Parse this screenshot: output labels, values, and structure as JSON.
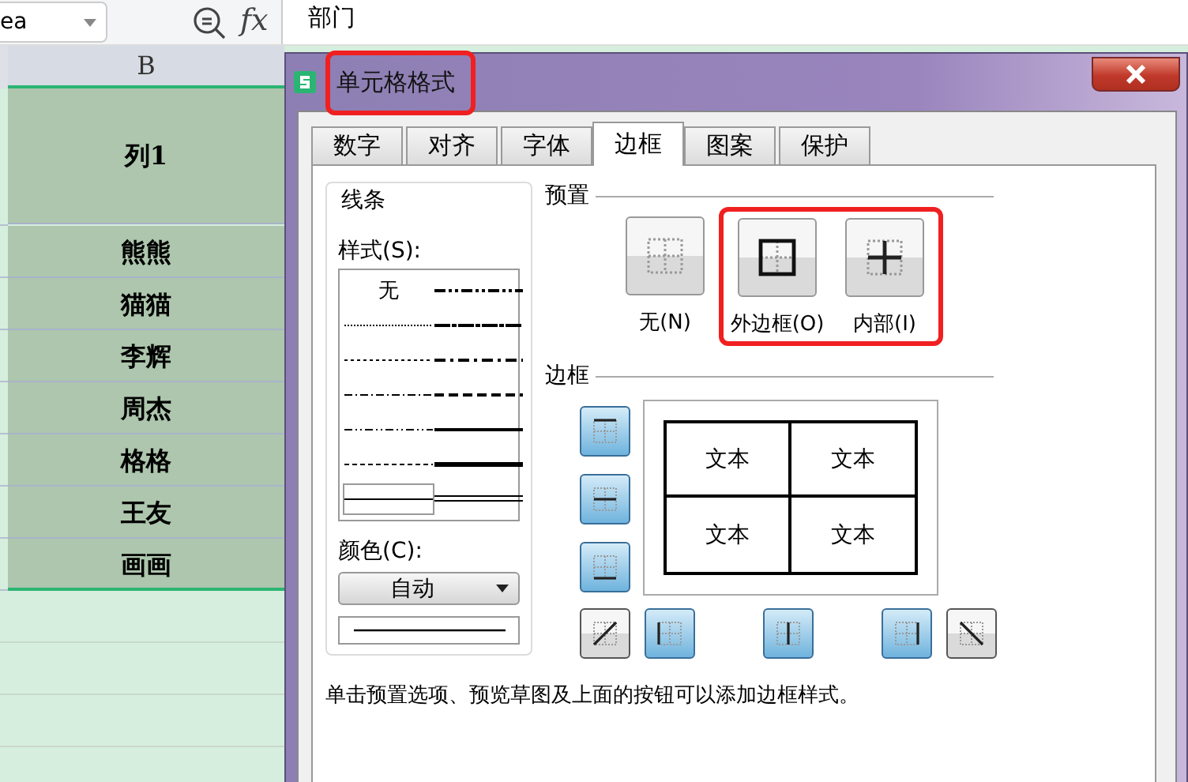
{
  "name_box": {
    "value": "ea"
  },
  "function_label": "fx",
  "formula_bar": {
    "value": "部门"
  },
  "sheet": {
    "column_header": "B",
    "header_cell": "列1",
    "rows": [
      "熊熊",
      "猫猫",
      "李辉",
      "周杰",
      "格格",
      "王友",
      "画画"
    ]
  },
  "dialog": {
    "title": "单元格格式",
    "title_highlighted": true,
    "tabs": [
      {
        "label": "数字",
        "selected": false
      },
      {
        "label": "对齐",
        "selected": false
      },
      {
        "label": "字体",
        "selected": false
      },
      {
        "label": "边框",
        "selected": true
      },
      {
        "label": "图案",
        "selected": false
      },
      {
        "label": "保护",
        "selected": false
      }
    ],
    "line_group": {
      "title": "线条",
      "style_label": "样式(S):",
      "styles": [
        {
          "kind": "none",
          "label": "无",
          "selected": false
        },
        {
          "kind": "medium-dash-dot-dot",
          "selected": false
        },
        {
          "kind": "hair",
          "selected": false
        },
        {
          "kind": "slant-dash-dot",
          "selected": false
        },
        {
          "kind": "dotted",
          "selected": false
        },
        {
          "kind": "medium-dash-dot",
          "selected": false
        },
        {
          "kind": "dash-dot",
          "selected": false
        },
        {
          "kind": "medium-dashed",
          "selected": false
        },
        {
          "kind": "dash-dot-dot",
          "selected": false
        },
        {
          "kind": "medium",
          "selected": false
        },
        {
          "kind": "dashed",
          "selected": false
        },
        {
          "kind": "thick",
          "selected": false
        },
        {
          "kind": "thin",
          "selected": true
        },
        {
          "kind": "double",
          "selected": false
        }
      ],
      "color_label": "颜色(C):",
      "color_value": "自动"
    },
    "presets": {
      "title": "预置",
      "items": [
        {
          "kind": "none",
          "label": "无(N)",
          "highlighted": false
        },
        {
          "kind": "outline",
          "label": "外边框(O)",
          "highlighted": true
        },
        {
          "kind": "inside",
          "label": "内部(I)",
          "highlighted": true
        }
      ]
    },
    "border": {
      "title": "边框",
      "side_buttons": [
        {
          "kind": "top",
          "on": true
        },
        {
          "kind": "inside-horizontal",
          "on": true
        },
        {
          "kind": "bottom",
          "on": true
        }
      ],
      "bottom_buttons": [
        {
          "kind": "diagonal-up",
          "on": false
        },
        {
          "kind": "left",
          "on": true
        },
        {
          "kind": "inside-vertical",
          "on": true
        },
        {
          "kind": "right",
          "on": true
        },
        {
          "kind": "diagonal-down",
          "on": false
        }
      ],
      "preview_cells": [
        "文本",
        "文本",
        "文本",
        "文本"
      ]
    },
    "hint": "单击预置选项、预览草图及上面的按钮可以添加边框样式。"
  }
}
